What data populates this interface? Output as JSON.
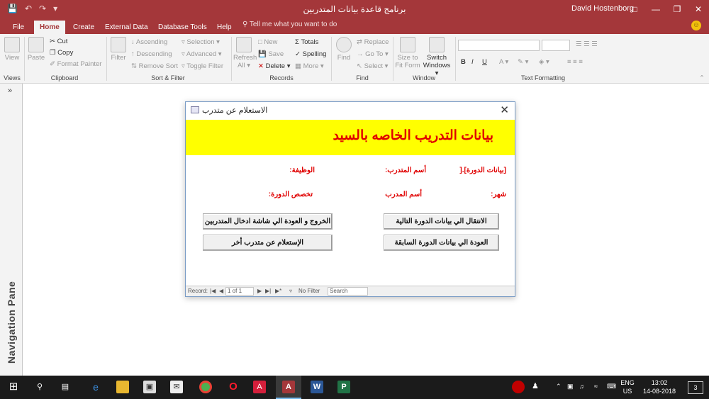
{
  "window": {
    "title": "برنامج قاعدة بيانات المتدربين",
    "user": "David Hostenborg"
  },
  "ribbon": {
    "tabs": [
      "File",
      "Home",
      "Create",
      "External Data",
      "Database Tools",
      "Help"
    ],
    "active_tab": "Home",
    "tell_me": "Tell me what you want to do",
    "views": {
      "view": "View",
      "label": "Views"
    },
    "clipboard": {
      "paste": "Paste",
      "cut": "Cut",
      "copy": "Copy",
      "format_painter": "Format Painter",
      "label": "Clipboard"
    },
    "sort_filter": {
      "filter": "Filter",
      "ascending": "Ascending",
      "descending": "Descending",
      "remove_sort": "Remove Sort",
      "selection": "Selection",
      "advanced": "Advanced",
      "toggle_filter": "Toggle Filter",
      "label": "Sort & Filter"
    },
    "records": {
      "refresh": "Refresh",
      "all": "All",
      "new": "New",
      "save": "Save",
      "delete": "Delete",
      "totals": "Totals",
      "spelling": "Spelling",
      "more": "More",
      "label": "Records"
    },
    "find": {
      "find": "Find",
      "replace": "Replace",
      "go_to": "Go To",
      "select": "Select",
      "label": "Find"
    },
    "window_grp": {
      "size_to_fit": "Size to",
      "size_to_fit2": "Fit Form",
      "switch": "Switch",
      "switch2": "Windows",
      "label": "Window"
    },
    "text_formatting": {
      "label": "Text Formatting"
    }
  },
  "nav_pane": {
    "label": "Navigation Pane",
    "toggle": "»"
  },
  "dialog": {
    "title": "الاستعلام عن متدرب",
    "heading": "بيانات التدريب الخاصه بالسيد",
    "fields": {
      "course_data": "[بيانات الدورة].[",
      "trainee_name": "أسم المتدرب:",
      "job": "الوظيفة:",
      "month": "شهر:",
      "trainer_name": "أسم المدرب",
      "course_spec": "تخصص الدورة:"
    },
    "buttons": {
      "next_course": "الانتقال الي بيانات الدورة التالية",
      "exit_back": "الخروج و العودة الي شاشة ادخال المتدربين",
      "prev_course": "العودة الي بيانات الدورة السابقة",
      "query_other": "الإستعلام عن متدرب أخر"
    },
    "record_nav": {
      "label": "Record:",
      "position": "1 of 1",
      "no_filter": "No Filter",
      "search": "Search"
    }
  },
  "taskbar": {
    "language": "ENG",
    "region": "US",
    "time": "13:02",
    "date": "14-08-2018",
    "notifications": "3"
  },
  "colors": {
    "access_accent": "#a4373a",
    "banner": "#ffff00",
    "heading_text": "#e00000"
  }
}
